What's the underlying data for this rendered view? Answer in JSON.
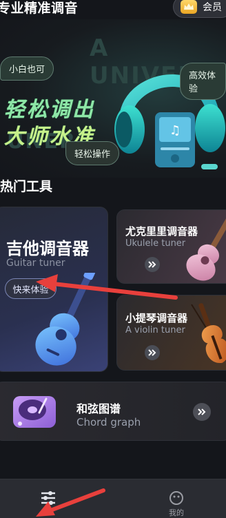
{
  "header": {
    "title": "专业精准调音",
    "vip_label": "会员",
    "vip_icon": "crown-icon"
  },
  "hero": {
    "bg_text_1": "A UNIVER",
    "bg_text_2": "UNER",
    "bubble_1": "小白也可",
    "bubble_2": "高效体验",
    "bubble_3": "轻松操作",
    "line_1": "轻松调出",
    "line_2": "大师水准"
  },
  "section": {
    "title": "热门工具"
  },
  "tools": {
    "guitar": {
      "title": "吉他调音器",
      "subtitle": "Guitar tuner",
      "try_label": "快来体验"
    },
    "ukulele": {
      "title": "尤克里里调音器",
      "subtitle": "Ukulele tuner"
    },
    "violin": {
      "title": "小提琴调音器",
      "subtitle": "A violin tuner"
    },
    "chord": {
      "title": "和弦图谱",
      "subtitle": "Chord graph"
    }
  },
  "tabbar": {
    "tab_1_icon": "sliders-icon",
    "tab_2_icon": "smiley-icon",
    "tab_2_label": "我的"
  },
  "colors": {
    "background": "#14161b",
    "accent_green": "#b9f27f",
    "annotation_red": "#e8403c"
  }
}
